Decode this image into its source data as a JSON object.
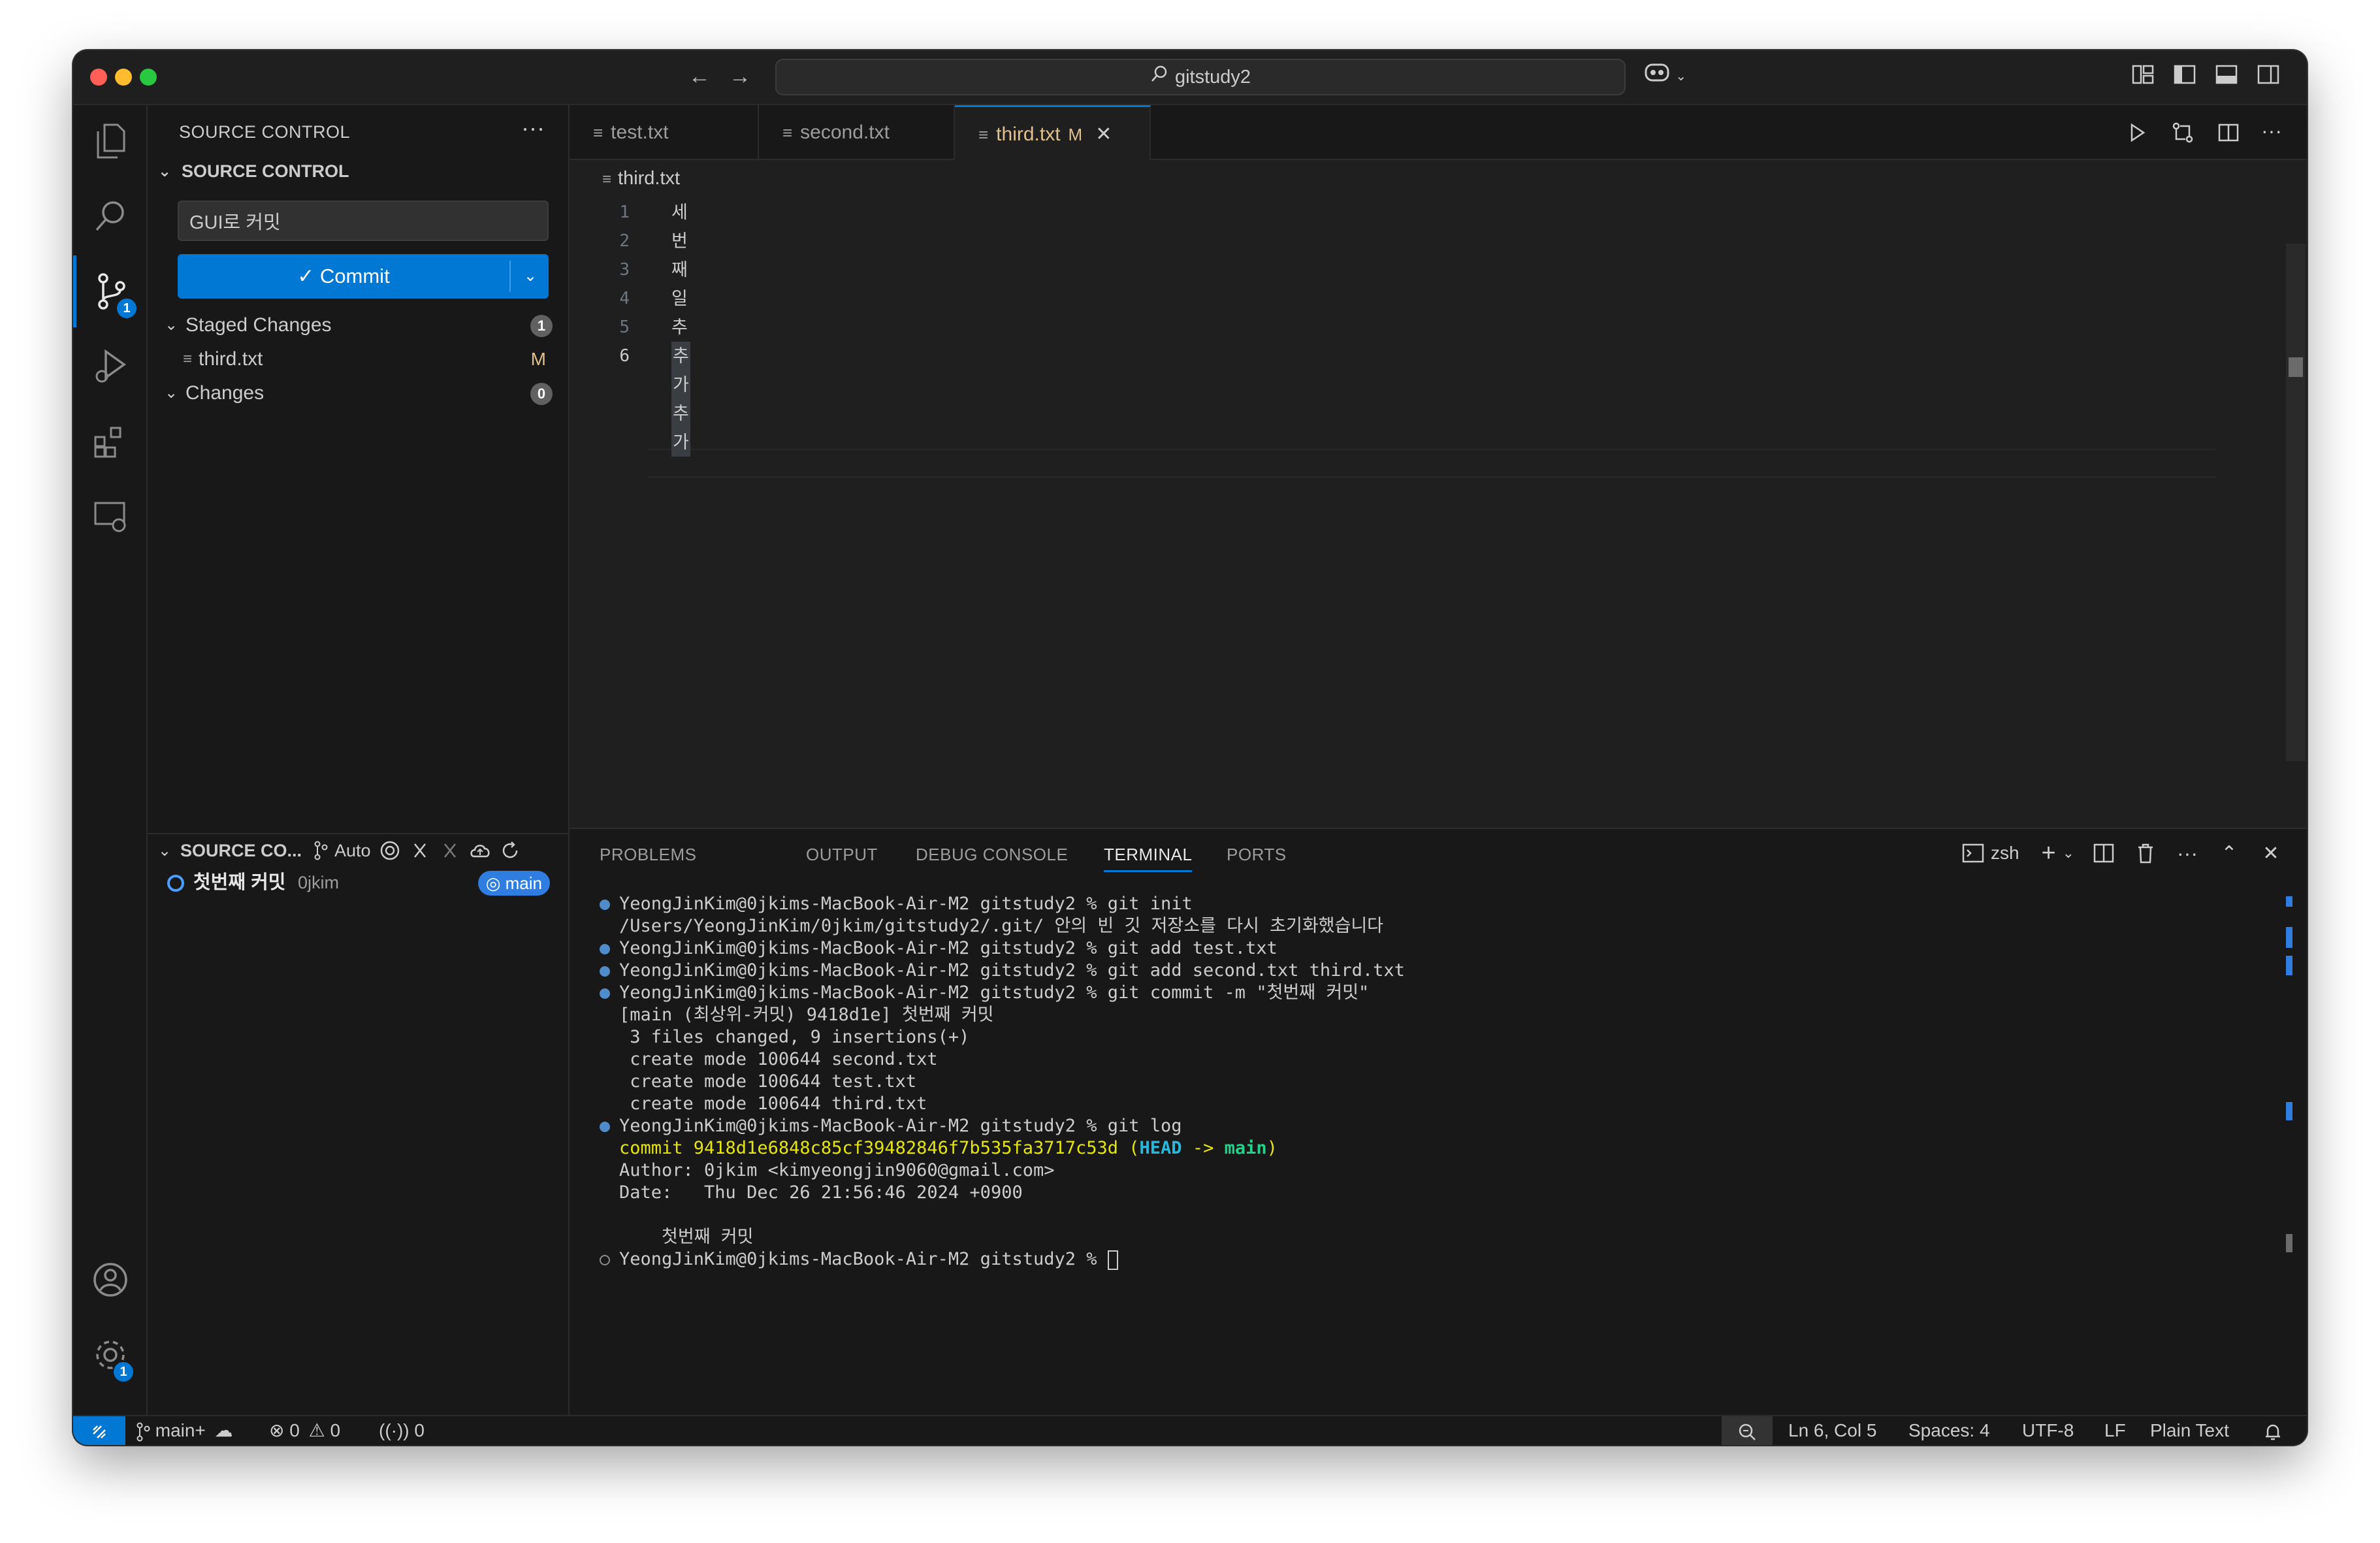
{
  "window": {
    "search_text": "gitstudy2",
    "traffic_colors": [
      "#ff5f57",
      "#febc2e",
      "#28c840"
    ]
  },
  "activity_bar": {
    "source_control_badge": "1",
    "settings_badge": "1"
  },
  "sidebar": {
    "title": "SOURCE CONTROL",
    "section_title": "SOURCE CONTROL",
    "commit_message": "GUI로 커밋",
    "commit_label": "Commit",
    "commit_check": "✓",
    "staged": {
      "label": "Staged Changes",
      "count": "1"
    },
    "staged_files": [
      {
        "name": "third.txt",
        "status": "M"
      }
    ],
    "changes": {
      "label": "Changes",
      "count": "0"
    },
    "graph": {
      "title": "SOURCE CO...",
      "auto_label": "Auto",
      "commit_message": "첫번째 커밋",
      "author": "0jkim",
      "branch": "main"
    }
  },
  "editor": {
    "tabs": [
      {
        "label": "test.txt"
      },
      {
        "label": "second.txt"
      },
      {
        "label": "third.txt",
        "status": "M"
      }
    ],
    "breadcrumb": "third.txt",
    "lines": [
      {
        "n": "1",
        "text": "세"
      },
      {
        "n": "2",
        "text": "번"
      },
      {
        "n": "3",
        "text": "째"
      },
      {
        "n": "4",
        "text": "일"
      },
      {
        "n": "5",
        "text": "추가"
      },
      {
        "n": "6",
        "text": "추가추가"
      }
    ]
  },
  "panel": {
    "tabs": [
      "PROBLEMS",
      "OUTPUT",
      "DEBUG CONSOLE",
      "TERMINAL",
      "PORTS"
    ],
    "shell": "zsh",
    "terminal": {
      "l1": "YeongJinKim@0jkims-MacBook-Air-M2 gitstudy2 % git init",
      "l2": "/Users/YeongJinKim/0jkim/gitstudy2/.git/ 안의 빈 깃 저장소를 다시 초기화했습니다",
      "l3": "YeongJinKim@0jkims-MacBook-Air-M2 gitstudy2 % git add test.txt",
      "l4": "YeongJinKim@0jkims-MacBook-Air-M2 gitstudy2 % git add second.txt third.txt",
      "l5": "YeongJinKim@0jkims-MacBook-Air-M2 gitstudy2 % git commit -m \"첫번째 커밋\"",
      "l6": "[main (최상위-커밋) 9418d1e] 첫번째 커밋",
      "l7": " 3 files changed, 9 insertions(+)",
      "l8": " create mode 100644 second.txt",
      "l9": " create mode 100644 test.txt",
      "l10": " create mode 100644 third.txt",
      "l11": "YeongJinKim@0jkims-MacBook-Air-M2 gitstudy2 % git log",
      "l12_commit": "commit 9418d1e6848c85cf39482846f7b535fa3717c53d ",
      "l12_open": "(",
      "l12_head": "HEAD",
      "l12_arrow": " -> ",
      "l12_branch": "main",
      "l12_close": ")",
      "l13": "Author: 0jkim <kimyeongjin9060@gmail.com>",
      "l14": "Date:   Thu Dec 26 21:56:46 2024 +0900",
      "l15": "    첫번째 커밋",
      "l16": "YeongJinKim@0jkims-MacBook-Air-M2 gitstudy2 % "
    }
  },
  "statusbar": {
    "branch": "main+",
    "errors": "0",
    "warnings": "0",
    "ports": "0",
    "position": "Ln 6, Col 5",
    "spaces": "Spaces: 4",
    "encoding": "UTF-8",
    "eol": "LF",
    "language": "Plain Text"
  },
  "colors": {
    "accent": "#0078d4",
    "modified": "#e2c08d",
    "background": "#181818"
  }
}
